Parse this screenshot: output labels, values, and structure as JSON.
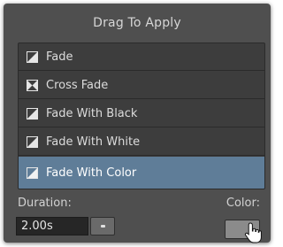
{
  "panel": {
    "title": "Drag To Apply"
  },
  "transitions": [
    {
      "label": "Fade",
      "icon": "fade-icon",
      "selected": false
    },
    {
      "label": "Cross Fade",
      "icon": "cross-fade-icon",
      "selected": false
    },
    {
      "label": "Fade With Black",
      "icon": "fade-black-icon",
      "selected": false
    },
    {
      "label": "Fade With White",
      "icon": "fade-white-icon",
      "selected": false
    },
    {
      "label": "Fade With Color",
      "icon": "fade-color-icon",
      "selected": true
    }
  ],
  "duration": {
    "label": "Duration:",
    "value": "2.00s"
  },
  "color": {
    "label": "Color:",
    "swatch": "#8b8b8b"
  },
  "colors": {
    "panel_bg": "#4f4f4f",
    "list_bg": "#3d3d3d",
    "selected_bg": "#5f7d98"
  }
}
